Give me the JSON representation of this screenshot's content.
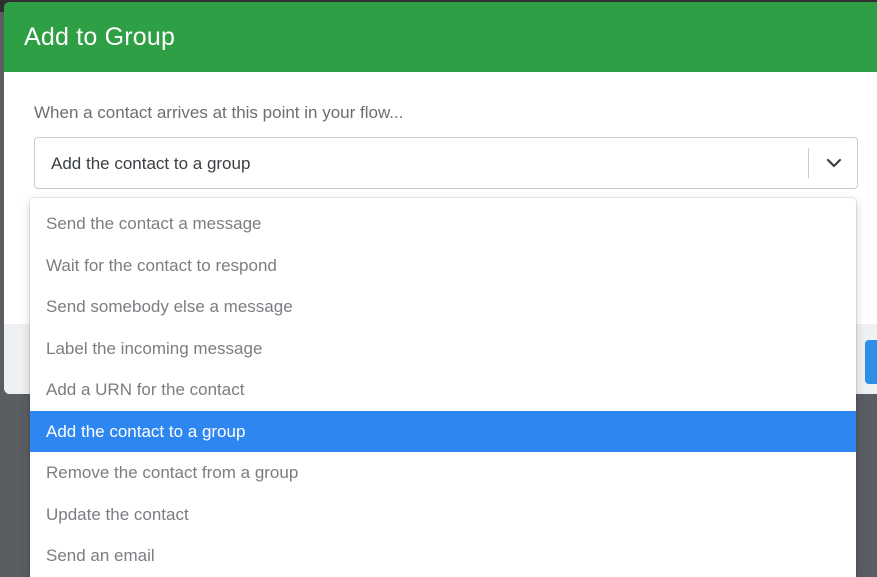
{
  "modal": {
    "title": "Add to Group"
  },
  "form": {
    "prompt": "When a contact arrives at this point in your flow...",
    "action_select": {
      "selected_value": "Add the contact to a group",
      "icon": "chevron-down-icon"
    }
  },
  "dropdown": {
    "options": [
      {
        "label": "Send the contact a message",
        "selected": false
      },
      {
        "label": "Wait for the contact to respond",
        "selected": false
      },
      {
        "label": "Send somebody else a message",
        "selected": false
      },
      {
        "label": "Label the incoming message",
        "selected": false
      },
      {
        "label": "Add a URN for the contact",
        "selected": false
      },
      {
        "label": "Add the contact to a group",
        "selected": true
      },
      {
        "label": "Remove the contact from a group",
        "selected": false
      },
      {
        "label": "Update the contact",
        "selected": false
      },
      {
        "label": "Send an email",
        "selected": false
      }
    ]
  },
  "colors": {
    "header_green": "#2f9f45",
    "selected_blue": "#2e86f0",
    "footer_button_blue": "#2d8fe6"
  }
}
